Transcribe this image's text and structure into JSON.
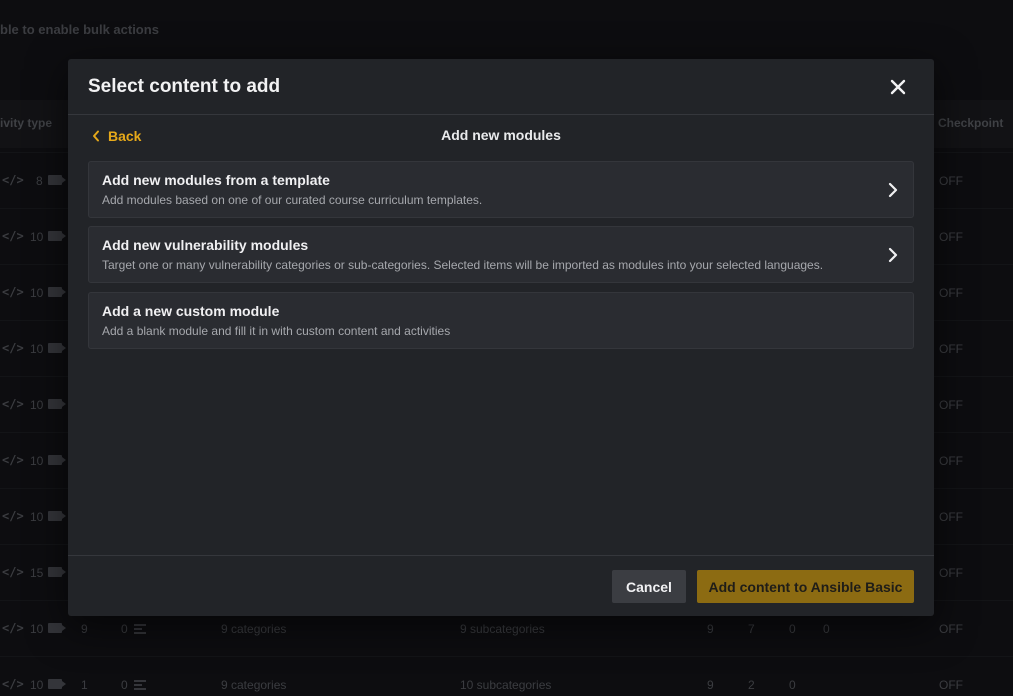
{
  "background": {
    "bulk_hint": "ble to enable bulk actions",
    "columns": {
      "activity_type": "ivity type",
      "checkpoint": "Checkpoint"
    },
    "rows": [
      {
        "code": "</>",
        "count": "8",
        "checkpoint": "OFF"
      },
      {
        "code": "</>",
        "count": "10",
        "checkpoint": "OFF"
      },
      {
        "code": "</>",
        "count": "10",
        "checkpoint": "OFF"
      },
      {
        "code": "</>",
        "count": "10",
        "checkpoint": "OFF"
      },
      {
        "code": "</>",
        "count": "10",
        "checkpoint": "OFF"
      },
      {
        "code": "</>",
        "count": "10",
        "checkpoint": "OFF"
      },
      {
        "code": "</>",
        "count": "10",
        "checkpoint": "OFF"
      },
      {
        "code": "</>",
        "count": "15",
        "checkpoint": "OFF"
      },
      {
        "code": "</>",
        "count": "10",
        "checkpoint": "OFF",
        "extra": {
          "a": "9",
          "b": "0",
          "categories": "9 categories",
          "subcategories": "9 subcategories",
          "c": "9",
          "d": "7",
          "e": "0",
          "f": "0"
        }
      },
      {
        "code": "</>",
        "count": "10",
        "checkpoint": "OFF",
        "extra": {
          "a": "1",
          "b": "0",
          "categories": "9 categories",
          "subcategories": "10 subcategories",
          "c": "9",
          "d": "2",
          "e": "0"
        }
      }
    ]
  },
  "modal": {
    "title": "Select content to add",
    "close_icon": "close-icon",
    "back_label": "Back",
    "subtitle": "Add new modules",
    "options": [
      {
        "title": "Add new modules from a template",
        "description": "Add modules based on one of our curated course curriculum templates.",
        "has_chevron": true
      },
      {
        "title": "Add new vulnerability modules",
        "description": "Target one or many vulnerability categories or sub-categories. Selected items will be imported as modules into your selected languages.",
        "has_chevron": true
      },
      {
        "title": "Add a new custom module",
        "description": "Add a blank module and fill it in with custom content and activities",
        "has_chevron": false
      }
    ],
    "cancel_label": "Cancel",
    "primary_label": "Add content to Ansible Basic"
  },
  "colors": {
    "accent": "#e6a91a",
    "primary_button": "#8c6b12",
    "modal_bg": "#222428",
    "option_bg": "#2a2c31"
  }
}
